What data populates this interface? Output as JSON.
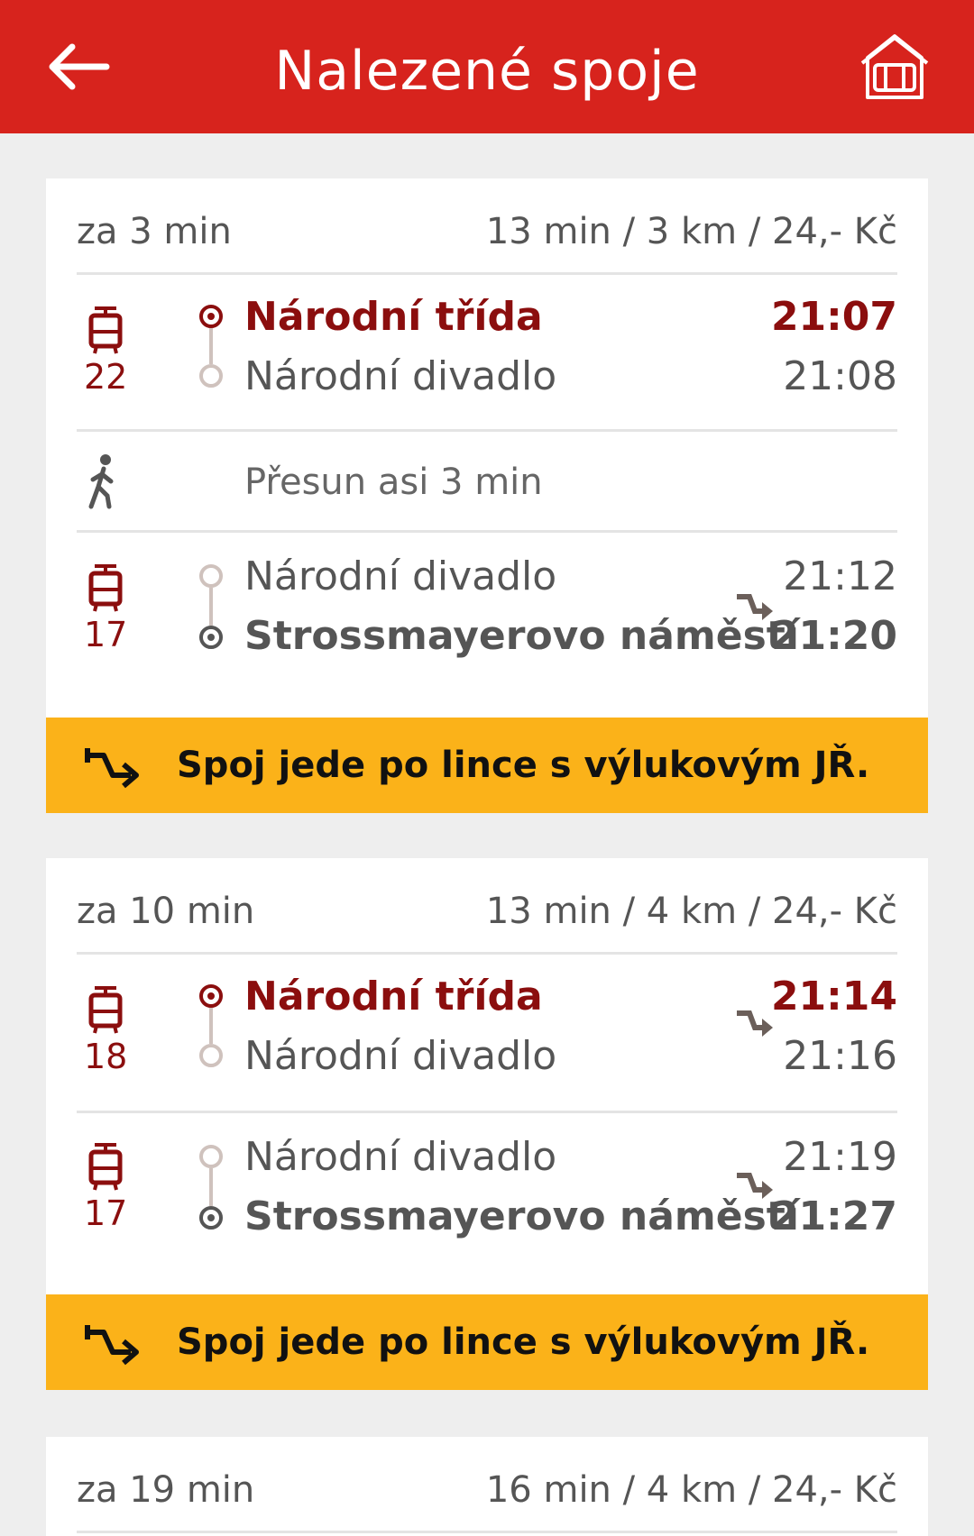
{
  "header": {
    "title": "Nalezené spoje",
    "back_icon": "arrow-left-icon",
    "home_icon": "station-home-icon",
    "color": "#d7231d"
  },
  "connections": [
    {
      "when": "za 3 min",
      "summary": "13 min / 3 km / 24,- Kč",
      "legs": [
        {
          "type": "tram",
          "line": "22",
          "from": "Národní třída",
          "to": "Národní divadlo",
          "dep": "21:07",
          "arr": "21:08"
        },
        {
          "type": "walk",
          "text": "Přesun asi 3 min"
        },
        {
          "type": "tram",
          "line": "17",
          "from": "Národní divadlo",
          "to": "Strossmayerovo náměstí",
          "dep": "21:12",
          "arr": "21:20",
          "marker": "detour-icon"
        }
      ],
      "notice": "Spoj jede po lince s výlukovým JŘ."
    },
    {
      "when": "za 10 min",
      "summary": "13 min / 4 km / 24,- Kč",
      "legs": [
        {
          "type": "tram",
          "line": "18",
          "from": "Národní třída",
          "to": "Národní divadlo",
          "dep": "21:14",
          "arr": "21:16",
          "marker": "detour-icon"
        },
        {
          "type": "tram",
          "line": "17",
          "from": "Národní divadlo",
          "to": "Strossmayerovo náměstí",
          "dep": "21:19",
          "arr": "21:27",
          "marker": "detour-icon"
        }
      ],
      "notice": "Spoj jede po lince s výlukovým JŘ."
    },
    {
      "when": "za 19 min",
      "summary": "16 min / 4 km / 24,- Kč"
    }
  ],
  "colors": {
    "accent": "#d7231d",
    "stop_highlight": "#8b0e0e",
    "notice_bg": "#fbb219"
  }
}
